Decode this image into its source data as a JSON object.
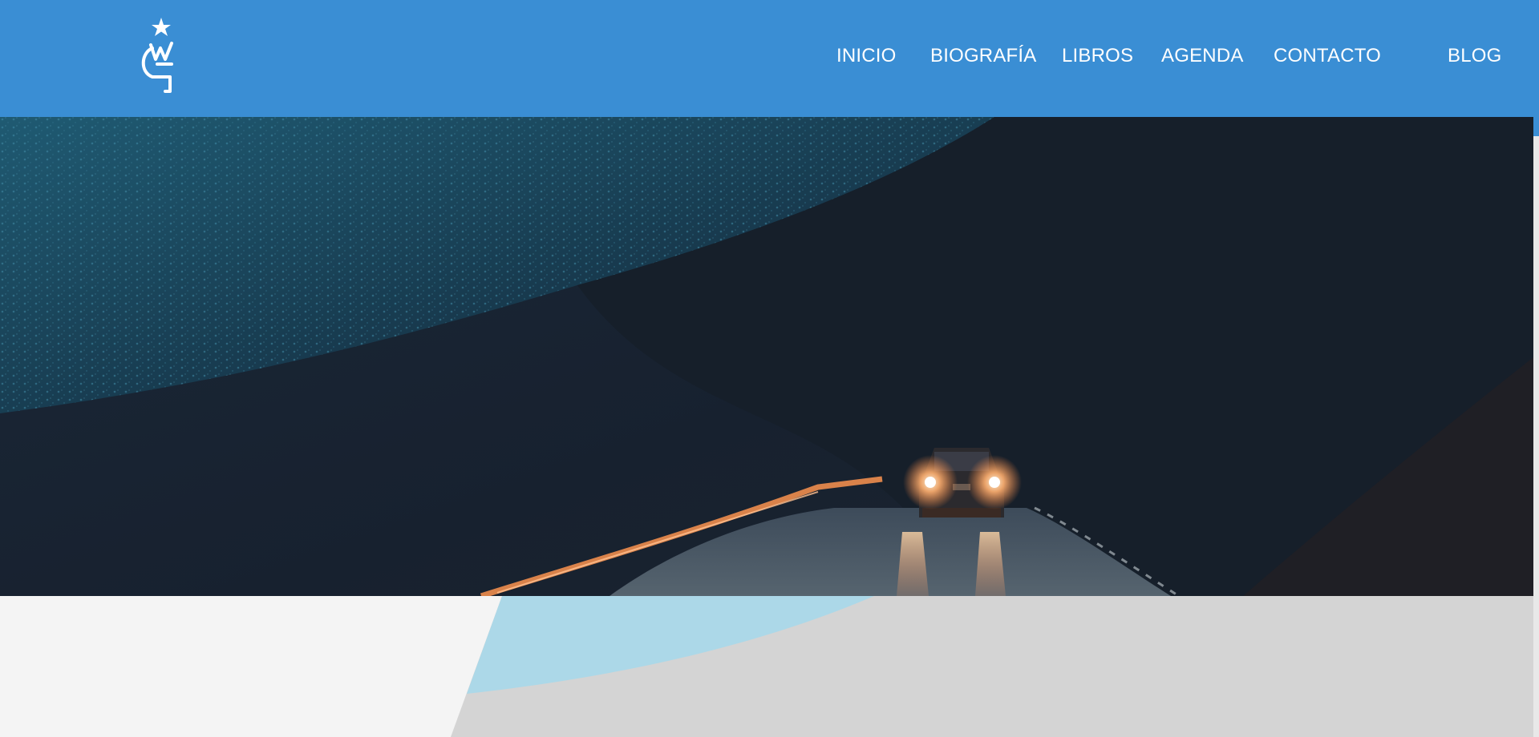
{
  "header": {
    "background_color": "#3a8ed4",
    "logo": {
      "name": "star-wg-logo",
      "color": "#ffffff"
    },
    "nav": [
      {
        "label": "INICIO"
      },
      {
        "label": "BIOGRAFÍA"
      },
      {
        "label": "LIBROS"
      },
      {
        "label": "AGENDA"
      },
      {
        "label": "CONTACTO"
      },
      {
        "label": "BLOG"
      }
    ]
  },
  "hero": {
    "subject": "car with headlights on a dark mountain road at night",
    "colors": {
      "sky_dark": "#17212f",
      "hill_blue": "#1f4f66",
      "headlight": "#ffb070",
      "road": "#4a5868"
    }
  },
  "bottom": {
    "colors": {
      "light_panel": "#f4f4f4",
      "light_blue": "#acd8e8",
      "grey": "#d4d4d4"
    }
  }
}
